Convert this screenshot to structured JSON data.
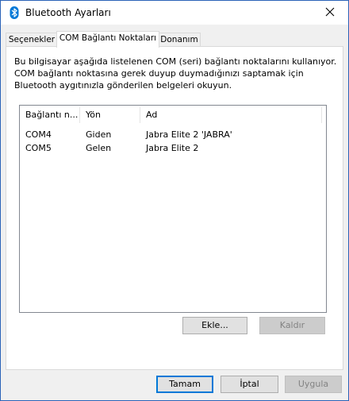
{
  "window": {
    "title": "Bluetooth Ayarları",
    "icons": {
      "app": "bluetooth-icon",
      "close": "close-icon"
    }
  },
  "tabs": [
    {
      "label": "Seçenekler",
      "active": false
    },
    {
      "label": "COM Bağlantı Noktaları",
      "active": true
    },
    {
      "label": "Donanım",
      "active": false
    }
  ],
  "description": {
    "line1": "Bu bilgisayar aşağıda listelenen COM (seri) bağlantı noktalarını kullanıyor.",
    "line2": "COM bağlantı noktasına gerek duyup duymadığınızı saptamak için",
    "line3": "Bluetooth aygıtınızla gönderilen belgeleri okuyun."
  },
  "port_list": {
    "columns": [
      "Bağlantı n...",
      "Yön",
      "Ad"
    ],
    "rows": [
      {
        "port": "COM4",
        "direction": "Giden",
        "name": "Jabra Elite 2 'JABRA'"
      },
      {
        "port": "COM5",
        "direction": "Gelen",
        "name": "Jabra Elite 2"
      }
    ]
  },
  "list_buttons": {
    "add": "Ekle...",
    "remove": "Kaldır"
  },
  "dialog_buttons": {
    "ok": "Tamam",
    "cancel": "İptal",
    "apply": "Uygula"
  },
  "colors": {
    "window_border": "#2b63b8",
    "accent": "#0078d7",
    "bluetooth_blue": "#0078d7"
  }
}
